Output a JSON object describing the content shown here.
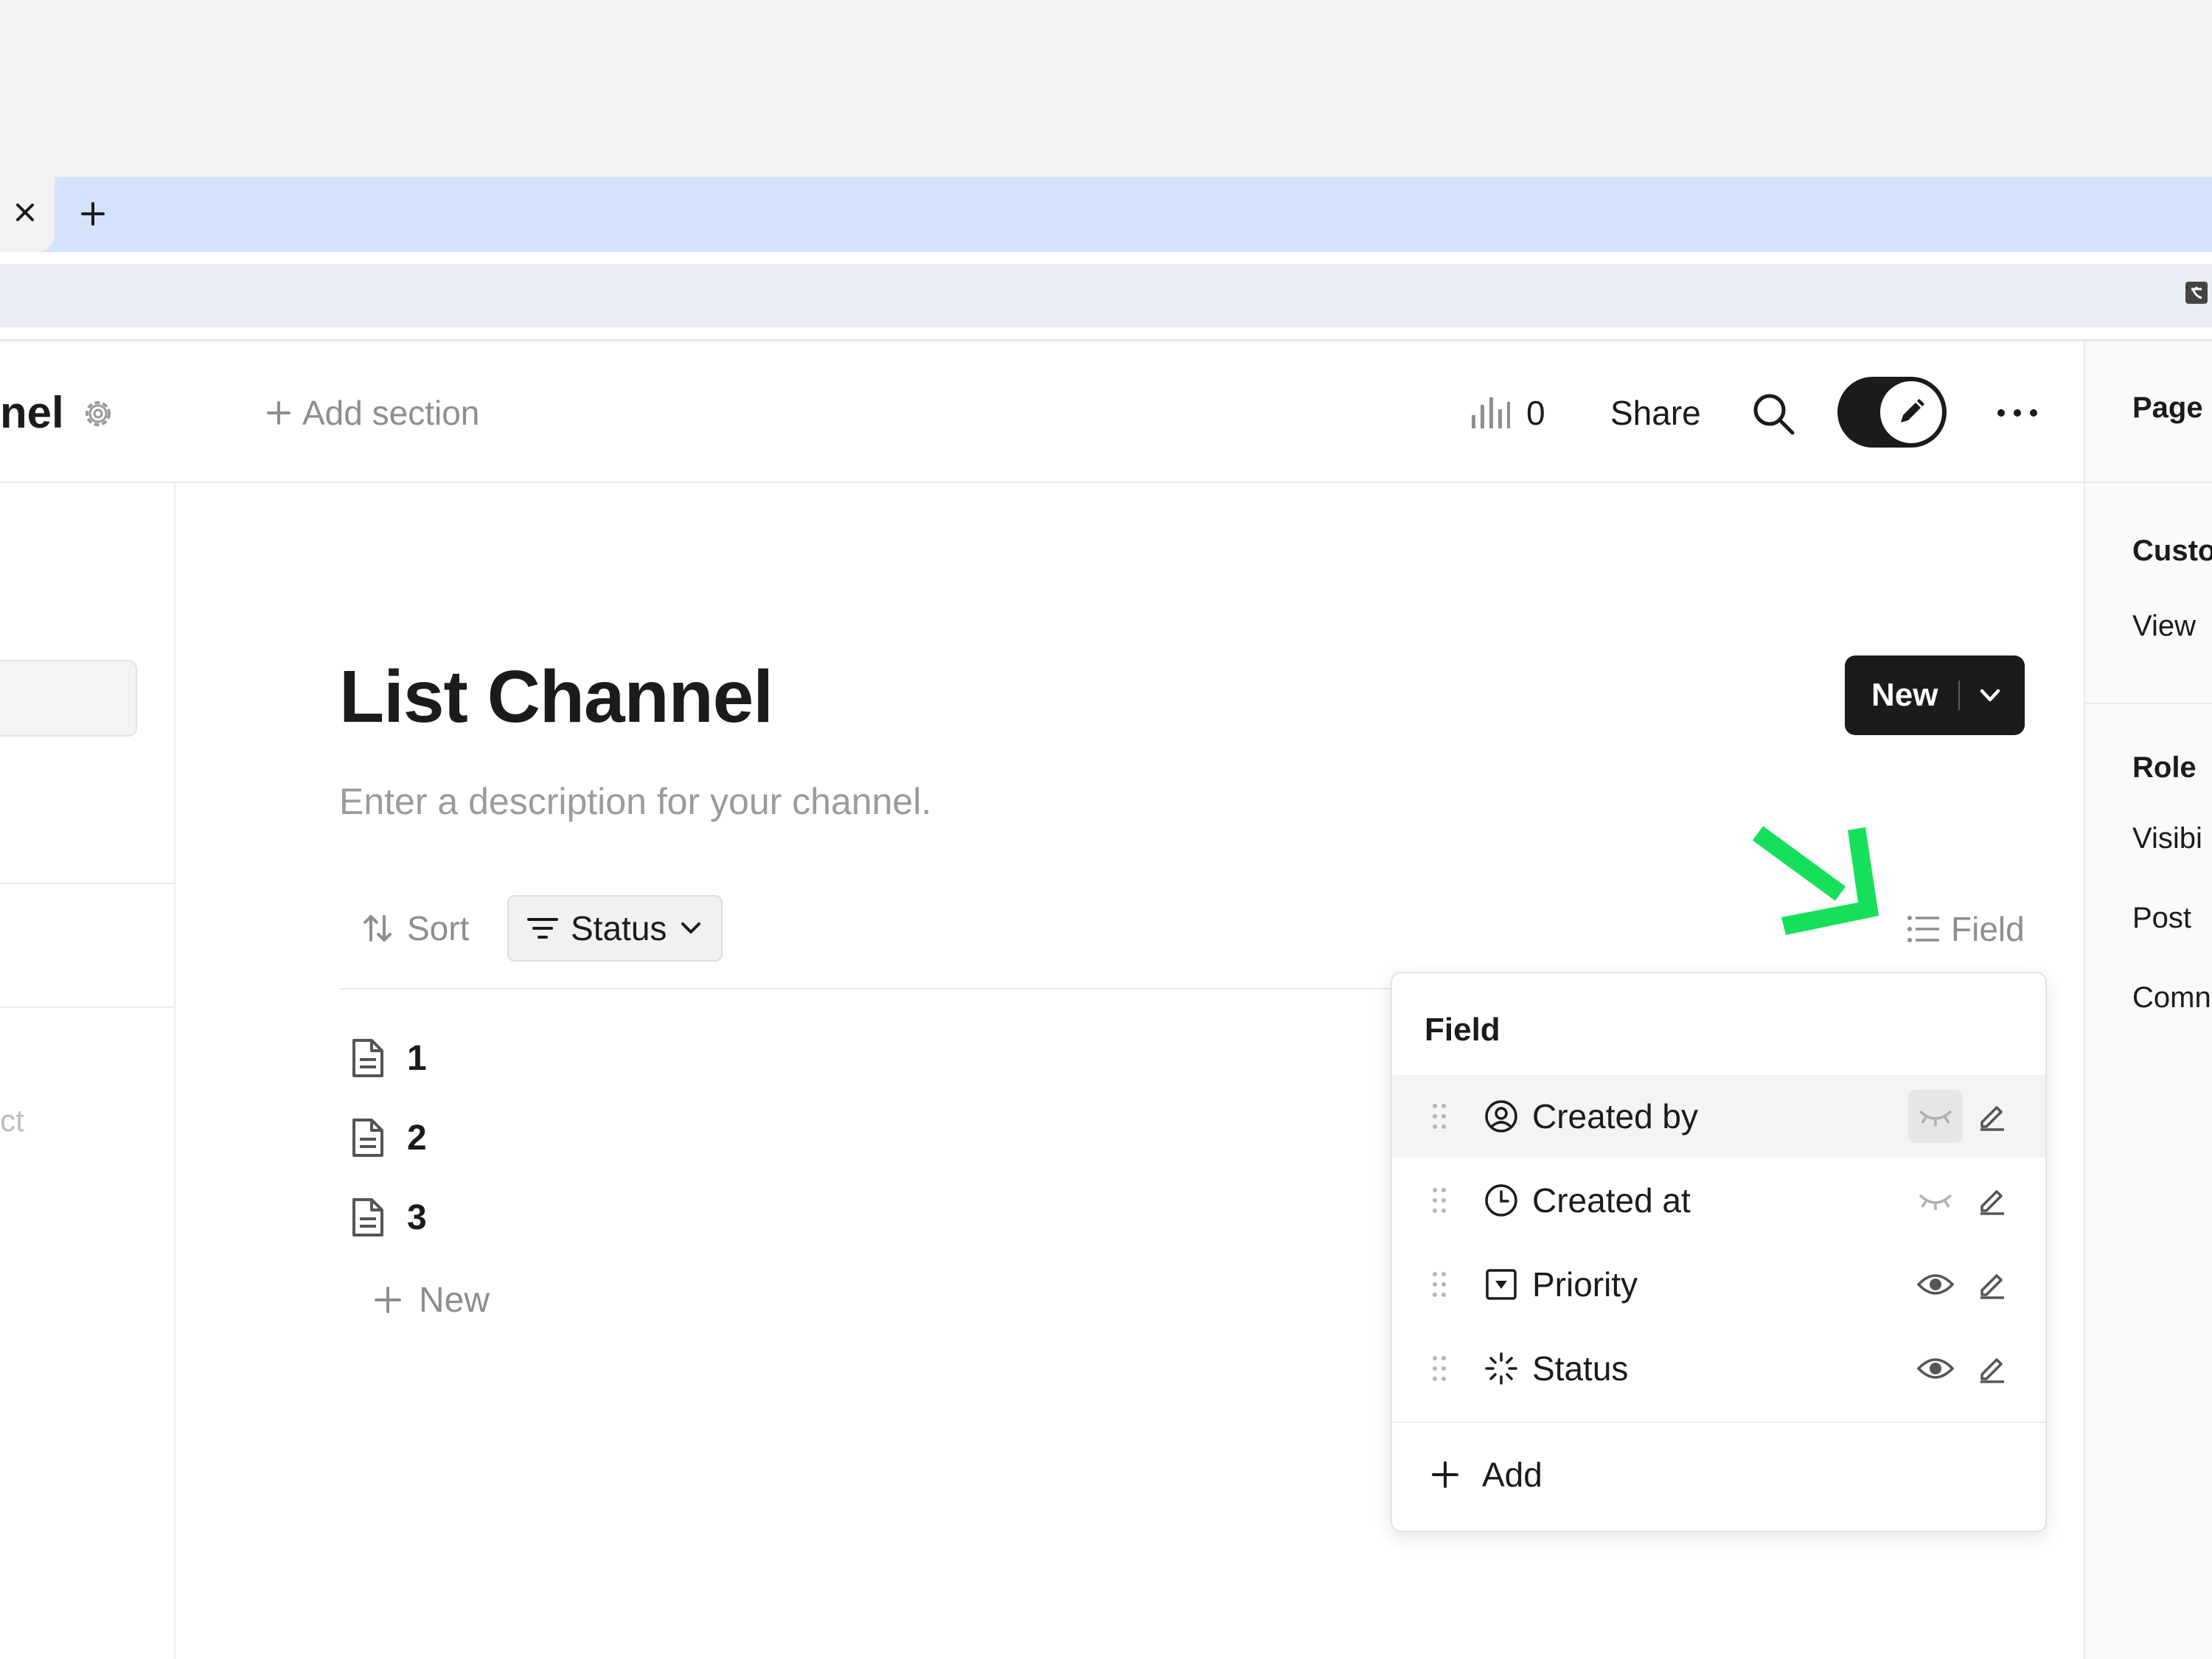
{
  "browser": {
    "tab_close_glyph": "×",
    "new_tab_glyph": "+"
  },
  "header": {
    "channel_title_fragment": "nel",
    "add_section_label": "Add section",
    "view_count": "0",
    "share_label": "Share"
  },
  "right_panel": {
    "page_label": "Page",
    "items": [
      "Custo",
      "View",
      "Role",
      "Visibi",
      "Post",
      "Comn"
    ]
  },
  "left_sidebar": {
    "partial_text": "ct"
  },
  "main": {
    "title": "List Channel",
    "description_placeholder": "Enter a description for your channel.",
    "new_button_label": "New",
    "sort_label": "Sort",
    "filter_label": "Status",
    "field_label": "Field",
    "rows": [
      "1",
      "2",
      "3"
    ],
    "add_row_label": "New"
  },
  "field_popover": {
    "title": "Field",
    "fields": [
      {
        "label": "Created by",
        "icon": "user-circle-icon",
        "visibility": "hidden",
        "highlighted": true
      },
      {
        "label": "Created at",
        "icon": "clock-icon",
        "visibility": "hidden",
        "highlighted": false
      },
      {
        "label": "Priority",
        "icon": "select-box-icon",
        "visibility": "visible",
        "highlighted": false
      },
      {
        "label": "Status",
        "icon": "loader-icon",
        "visibility": "visible",
        "highlighted": false
      }
    ],
    "add_label": "Add"
  },
  "colors": {
    "annotation_arrow": "#16e05a",
    "dark": "#1b1b1b",
    "muted_text": "#8e8e8e",
    "tabstrip": "#d3e3fd"
  }
}
